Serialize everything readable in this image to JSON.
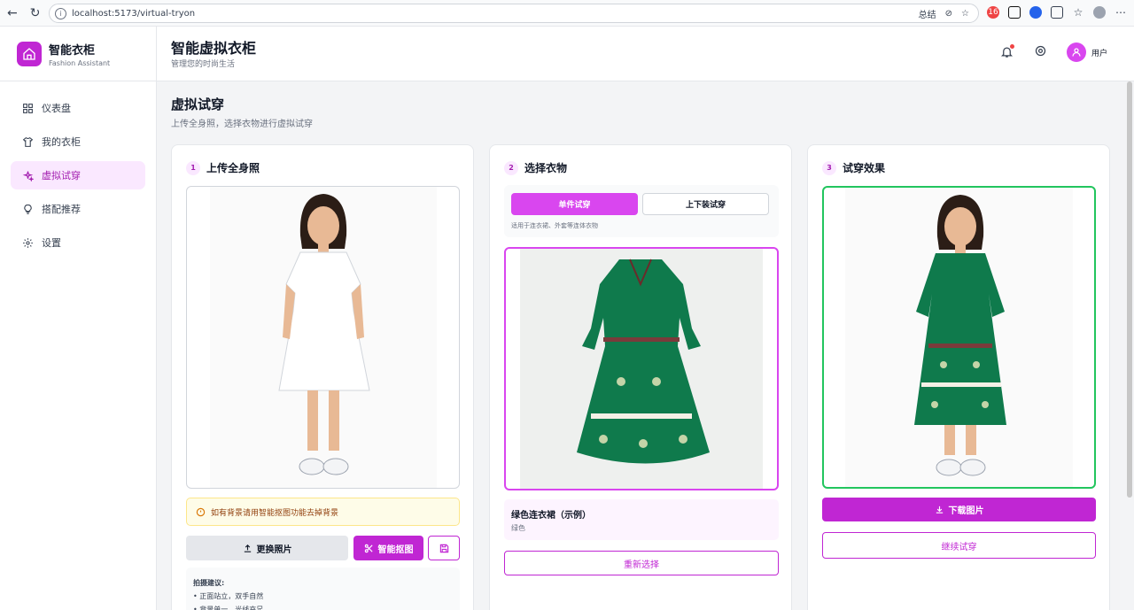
{
  "browser": {
    "url": "localhost:5173/virtual-tryon",
    "summary_label": "总结"
  },
  "brand": {
    "title": "智能衣柜",
    "subtitle": "Fashion Assistant"
  },
  "sidebar": {
    "items": [
      {
        "label": "仪表盘",
        "icon": "dashboard-icon"
      },
      {
        "label": "我的衣柜",
        "icon": "shirt-icon"
      },
      {
        "label": "虚拟试穿",
        "icon": "sparkle-icon",
        "active": true
      },
      {
        "label": "搭配推荐",
        "icon": "lightbulb-icon"
      },
      {
        "label": "设置",
        "icon": "gear-icon"
      }
    ]
  },
  "header": {
    "title": "智能虚拟衣柜",
    "subtitle": "管理您的时尚生活",
    "user_label": "用户"
  },
  "page": {
    "title": "虚拟试穿",
    "subtitle": "上传全身照，选择衣物进行虚拟试穿"
  },
  "upload": {
    "step": "1",
    "title": "上传全身照",
    "notice": "如有背景请用智能抠图功能去掉背景",
    "replace_label": "更换照片",
    "cutout_label": "智能抠图",
    "tips_title": "拍摄建议:",
    "tips": [
      "• 正面站立，双手自然",
      "• 背景单一，光线充足"
    ]
  },
  "select": {
    "step": "2",
    "title": "选择衣物",
    "tab_single": "单件试穿",
    "tab_set": "上下装试穿",
    "hint": "适用于连衣裙、外套等连体衣物",
    "item_name": "绿色连衣裙（示例）",
    "item_color": "绿色",
    "reselect_label": "重新选择"
  },
  "result": {
    "step": "3",
    "title": "试穿效果",
    "download_label": "下载图片",
    "continue_label": "继续试穿"
  },
  "colors": {
    "accent": "#c026d3",
    "accent_light": "#fae8ff",
    "dress_green": "#0f7a4c",
    "success_border": "#22c55e"
  }
}
